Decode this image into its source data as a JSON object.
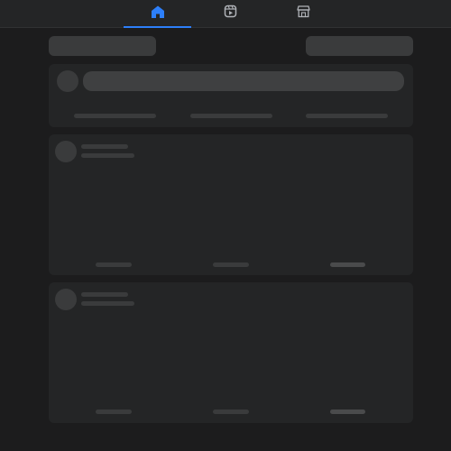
{
  "nav": {
    "tabs": [
      {
        "name": "home-icon",
        "active": true
      },
      {
        "name": "reels-icon",
        "active": false
      },
      {
        "name": "marketplace-icon",
        "active": false
      }
    ],
    "accent": "#2d7ff9"
  },
  "colors": {
    "background": "#1c1c1d",
    "card": "#242526",
    "skeleton": "#3a3b3c",
    "skeleton_light": "#4a4b4c"
  }
}
